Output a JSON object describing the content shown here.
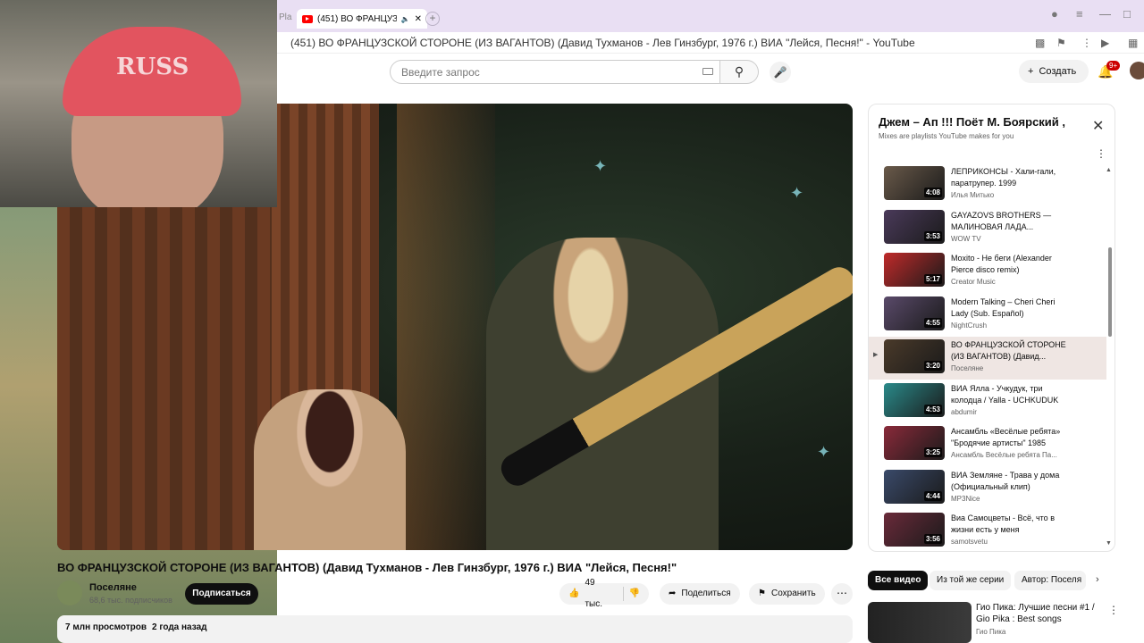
{
  "browser": {
    "tab_title": "(451) ВО ФРАНЦУЗС",
    "tab_left_text": "Pla",
    "new_tab_label": "+",
    "page_title": "(451) ВО ФРАНЦУЗСКОЙ СТОРОНЕ (ИЗ ВАГАНТОВ) (Давид Тухманов - Лев Гинзбург, 1976 г.) ВИА \"Лейся, Песня!\" - YouTube"
  },
  "header": {
    "search_placeholder": "Введите запрос",
    "create_label": "Создать",
    "notifications_badge": "9+"
  },
  "video": {
    "title": "ВО ФРАНЦУЗСКОЙ СТОРОНЕ (ИЗ ВАГАНТОВ) (Давид Тухманов - Лев Гинзбург, 1976 г.) ВИА \"Лейся, Песня!\"",
    "channel": "Поселяне",
    "subscribers": "68,6 тыс. подписчиков",
    "subscribe_label": "Подписаться",
    "likes": "49 тыс.",
    "share_label": "Поделиться",
    "save_label": "Сохранить",
    "views": "7 млн просмотров",
    "age": "2 года назад",
    "webcam_cap_text": "RUSS"
  },
  "playlist": {
    "title": "Джем – Ап !!! Поёт М. Боярский ,",
    "subtitle": "Mixes are playlists YouTube makes for you",
    "items": [
      {
        "title": "ЛЕПРИКОНСЫ - Хали-гали, паратрупер. 1999",
        "author": "Илья Митько",
        "duration": "4:08",
        "color": "#6a5a4a"
      },
      {
        "title": "GAYAZOVS BROTHERS — МАЛИНОВАЯ ЛАДА...",
        "author": "WOW TV",
        "duration": "3:53",
        "color": "#4a3a5a"
      },
      {
        "title": "Moxito - Не беги (Alexander Pierce disco remix)",
        "author": "Creator Music",
        "duration": "5:17",
        "color": "#c02a2a"
      },
      {
        "title": "Modern Talking – Cheri Cheri Lady (Sub. Español)",
        "author": "NightCrush",
        "duration": "4:55",
        "color": "#5a4a6a"
      },
      {
        "title": "ВО ФРАНЦУЗСКОЙ СТОРОНЕ (ИЗ ВАГАНТОВ) (Давид...",
        "author": "Поселяне",
        "duration": "3:20",
        "color": "#4a3a2a",
        "active": true
      },
      {
        "title": "ВИА Ялла - Учкудук, три колодца / Yalla - UCHKUDUK",
        "author": "abdumir",
        "duration": "4:53",
        "color": "#2a8a8a"
      },
      {
        "title": "Ансамбль «Весёлые ребята» \"Бродячие артисты\" 1985",
        "author": "Ансамбль Весёлые ребята Па...",
        "duration": "3:25",
        "color": "#8a2a3a"
      },
      {
        "title": "ВИА Земляне - Трава у дома (Официальный клип)",
        "author": "MP3Nice",
        "duration": "4:44",
        "color": "#3a4a6a"
      },
      {
        "title": "Виа Самоцветы - Всё, что в жизни есть у меня",
        "author": "samotsvetu",
        "duration": "3:56",
        "color": "#6a2a3a"
      }
    ]
  },
  "chips": [
    "Все видео",
    "Из той же серии",
    "Автор: Поселя"
  ],
  "recommendation": {
    "title": "Гио Пика: Лучшие песни #1 / Gio Pika : Best songs",
    "author": "Гио Пика"
  }
}
